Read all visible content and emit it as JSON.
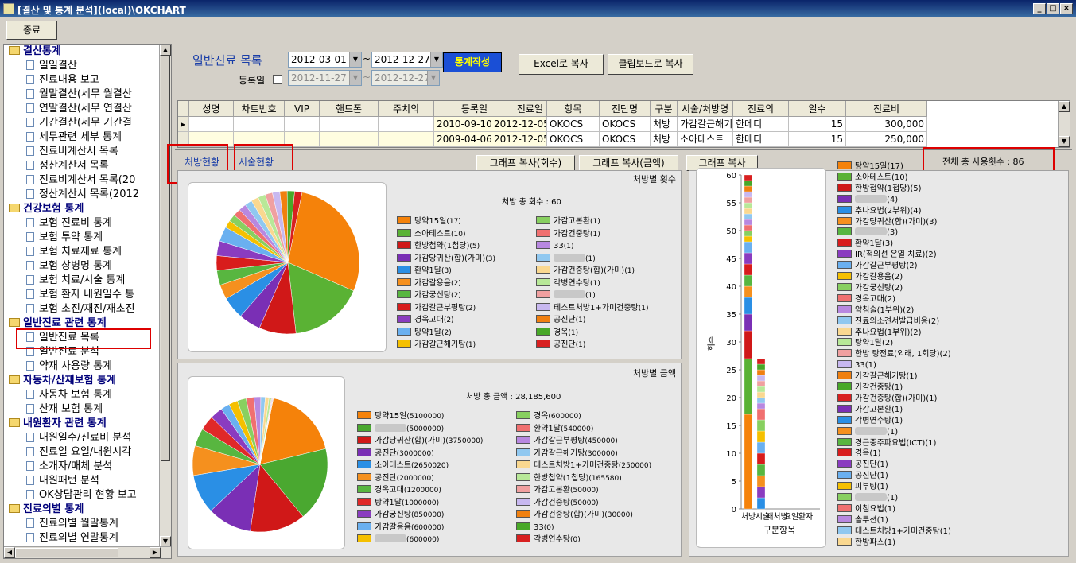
{
  "window": {
    "title": "[결산 및 통계 분석](local)\\OKCHART"
  },
  "toolbar": {
    "close_label": "종료"
  },
  "tree": [
    {
      "t": "h",
      "label": "결산통계"
    },
    {
      "t": "i",
      "label": "일일결산"
    },
    {
      "t": "i",
      "label": "진료내용 보고"
    },
    {
      "t": "i",
      "label": "월말결산(세무 월결산"
    },
    {
      "t": "i",
      "label": "연말결산(세무 연결산"
    },
    {
      "t": "i",
      "label": "기간결산(세무 기간결"
    },
    {
      "t": "i",
      "label": "세무관련 세부 통계"
    },
    {
      "t": "i",
      "label": "진료비계산서 목록"
    },
    {
      "t": "i",
      "label": "정산계산서 목록"
    },
    {
      "t": "i",
      "label": "진료비계산서 목록(20"
    },
    {
      "t": "i",
      "label": "정산계산서 목록(2012"
    },
    {
      "t": "h",
      "label": "건강보험 통계"
    },
    {
      "t": "i",
      "label": "보험 진료비 통계"
    },
    {
      "t": "i",
      "label": "보험 투약 통계"
    },
    {
      "t": "i",
      "label": "보험 치료재료 통계"
    },
    {
      "t": "i",
      "label": "보험 상병명 통계"
    },
    {
      "t": "i",
      "label": "보험 치료/시술 통계"
    },
    {
      "t": "i",
      "label": "보험 환자 내원일수 통"
    },
    {
      "t": "i",
      "label": "보험 초진/재진/재초진"
    },
    {
      "t": "h",
      "label": "일반진료 관련 통계"
    },
    {
      "t": "i",
      "label": "일반진료 목록"
    },
    {
      "t": "i",
      "label": "일반진료 분석"
    },
    {
      "t": "i",
      "label": "약재 사용량 통계"
    },
    {
      "t": "h",
      "label": "자동차/산재보험 통계"
    },
    {
      "t": "i",
      "label": "자동차 보험 통계"
    },
    {
      "t": "i",
      "label": "산재 보험 통계"
    },
    {
      "t": "h",
      "label": "내원환자 관련 통계"
    },
    {
      "t": "i",
      "label": "내원일수/진료비 분석"
    },
    {
      "t": "i",
      "label": "진료일 요일/내원시각"
    },
    {
      "t": "i",
      "label": "소개자/매체 분석"
    },
    {
      "t": "i",
      "label": "내원패턴 분석"
    },
    {
      "t": "i",
      "label": "OK상담관리 현황 보고"
    },
    {
      "t": "h",
      "label": "진료의별 통계"
    },
    {
      "t": "i",
      "label": "진료의별 월말통계"
    },
    {
      "t": "i",
      "label": "진료의별 연말통계"
    }
  ],
  "header": {
    "title": "일반진료 목록",
    "reg_label": "등록일",
    "tilde": "~",
    "from": "2012-03-01",
    "to": "2012-12-27",
    "reg_from": "2012-11-27",
    "reg_to": "2012-12-27",
    "stat_btn": "통계작성",
    "excel_btn": "Excel로 복사",
    "clip_btn": "클립보드로 복사"
  },
  "grid": {
    "columns": [
      "성명",
      "차트번호",
      "VIP",
      "핸드폰",
      "주치의",
      "등록일",
      "진료일",
      "항목",
      "진단명",
      "구분",
      "시술/처방명",
      "진료의",
      "일수",
      "진료비"
    ],
    "rows": [
      [
        "",
        "",
        "",
        "",
        "",
        "2010-09-10",
        "2012-12-05",
        "OKOCS",
        "OKOCS",
        "처방",
        "가감갈근해기",
        "한메디",
        "15",
        "300,000"
      ],
      [
        "",
        "",
        "",
        "",
        "",
        "2009-04-06",
        "2012-12-05",
        "OKOCS",
        "OKOCS",
        "처방",
        "소아테스트",
        "한메디",
        "15",
        "250,000"
      ]
    ]
  },
  "tabs": {
    "t1": "처방현황",
    "t2": "시술현황"
  },
  "buttons": {
    "copy_count": "그래프 복사(회수)",
    "copy_amount": "그래프 복사(금액)",
    "copy_graph": "그래프 복사"
  },
  "total_label": "전체 총 사용횟수 : 86",
  "count_panel": {
    "title": "처방별 횟수",
    "total": "처방 총 회수 : 60",
    "legend_left": [
      [
        "탕약15일",
        "(17)",
        "#f5820a"
      ],
      [
        "소아테스트",
        "(10)",
        "#5ab234"
      ],
      [
        "한방첩약(1첩당)",
        "(5)",
        "#d01818"
      ],
      [
        "가감당귀산(합)(가미)",
        "(3)",
        "#7a2fb5"
      ],
      [
        "환약1달",
        "(3)",
        "#2a8fe5"
      ],
      [
        "가감갈용음",
        "(2)",
        "#f5901e"
      ],
      [
        "가감궁신탕",
        "(2)",
        "#58b640"
      ],
      [
        "가감갈근부평탕",
        "(2)",
        "#d81c1c"
      ],
      [
        "경옥고대",
        "(2)",
        "#8a3cc0"
      ],
      [
        "탕약1달",
        "(2)",
        "#6ab0f0"
      ],
      [
        "가감갈근해기탕",
        "(1)",
        "#f5c000"
      ]
    ],
    "legend_right": [
      [
        "가감고본환",
        "(1)",
        "#88d060"
      ],
      [
        "가감건중탕",
        "(1)",
        "#f07070"
      ],
      [
        "33",
        "(1)",
        "#b888e0"
      ],
      [
        "",
        "(1)",
        "#90c8f0"
      ],
      [
        "가감건중탕(합)(가미)",
        "(1)",
        "#fad890"
      ],
      [
        "각병연수탕",
        "(1)",
        "#b8e898"
      ],
      [
        "",
        "(1)",
        "#f0a0a0"
      ],
      [
        "테스트처방1+가미건중탕",
        "(1)",
        "#c8b8f0"
      ],
      [
        "공진단",
        "(1)",
        "#f08010"
      ],
      [
        "경옥",
        "(1)",
        "#48a828"
      ],
      [
        "공진단",
        "(1)",
        "#d82020"
      ]
    ]
  },
  "amount_panel": {
    "title": "처방별 금액",
    "total": "처방 총 금액 : 28,185,600",
    "legend_left": [
      [
        "탕약15일",
        "(5100000)",
        "#f5820a"
      ],
      [
        "",
        "(5000000)",
        "#4aa830"
      ],
      [
        "가감당귀산(합)(가미)",
        "(3750000)",
        "#d01818"
      ],
      [
        "공진단",
        "(3000000)",
        "#7a2fb5"
      ],
      [
        "소아테스트",
        "(2650020)",
        "#2a8fe5"
      ],
      [
        "공진단",
        "(2000000)",
        "#f5901e"
      ],
      [
        "경옥고대",
        "(1200000)",
        "#58b640"
      ],
      [
        "탕약1달",
        "(1000000)",
        "#e02828"
      ],
      [
        "가감궁신탕",
        "(850000)",
        "#8a3cc0"
      ],
      [
        "가감갈용음",
        "(600000)",
        "#6ab0f0"
      ],
      [
        "",
        "(600000)",
        "#f5c000"
      ]
    ],
    "legend_right": [
      [
        "경옥",
        "(600000)",
        "#88d060"
      ],
      [
        "환약1달",
        "(540000)",
        "#f07070"
      ],
      [
        "가감갈근부평탕",
        "(450000)",
        "#b888e0"
      ],
      [
        "가감갈근해기탕",
        "(300000)",
        "#90c8f0"
      ],
      [
        "테스트처방1+가미건중탕",
        "(250000)",
        "#fad890"
      ],
      [
        "한방첩약(1첩당)",
        "(165580)",
        "#b8e898"
      ],
      [
        "가감고본환",
        "(50000)",
        "#f0a0a0"
      ],
      [
        "가감건중탕",
        "(50000)",
        "#c8b8f0"
      ],
      [
        "가감건중탕(합)(가미)",
        "(30000)",
        "#f08010"
      ],
      [
        "33",
        "(0)",
        "#48a828"
      ],
      [
        "각병연수탕",
        "(0)",
        "#d82020"
      ]
    ]
  },
  "bar_panel": {
    "ylabel": "회수",
    "xlabel": "구분항목",
    "xticks": [
      "처방",
      "시술",
      "재처방",
      "요일",
      "환자"
    ],
    "yticks": [
      "0",
      "5",
      "10",
      "15",
      "20",
      "25",
      "30",
      "35",
      "40",
      "45",
      "50",
      "55",
      "60"
    ],
    "legend": [
      [
        "탕약15일(17)",
        "#f5820a"
      ],
      [
        "소아테스트(10)",
        "#5ab234"
      ],
      [
        "한방첩약(1첩당)(5)",
        "#d01818"
      ],
      [
        "(4)",
        "#7a2fb5"
      ],
      [
        "추나요법(2부위)(4)",
        "#2a8fe5"
      ],
      [
        "가감당귀산(합)(가미)(3)",
        "#f5901e"
      ],
      [
        "(3)",
        "#58b640"
      ],
      [
        "환약1달(3)",
        "#d81c1c"
      ],
      [
        "IR(적외선 온열 치료)(2)",
        "#8a3cc0"
      ],
      [
        "가감갈근부평탕(2)",
        "#6ab0f0"
      ],
      [
        "가감갈용음(2)",
        "#f5c000"
      ],
      [
        "가감궁신탕(2)",
        "#88d060"
      ],
      [
        "경옥고대(2)",
        "#f07070"
      ],
      [
        "약침술(1부위)(2)",
        "#b888e0"
      ],
      [
        "진료의소견서발급비용(2)",
        "#90c8f0"
      ],
      [
        "추나요법(1부위)(2)",
        "#fad890"
      ],
      [
        "탕약1달(2)",
        "#b8e898"
      ],
      [
        "한방 탕전료(외래, 1회당)(2)",
        "#f0a0a0"
      ],
      [
        "33(1)",
        "#c8b8f0"
      ],
      [
        "가감갈근해기탕(1)",
        "#f08010"
      ],
      [
        "가감건중탕(1)",
        "#48a828"
      ],
      [
        "가감건중탕(합)(가미)(1)",
        "#d82020"
      ],
      [
        "가감고본환(1)",
        "#7a2fb5"
      ],
      [
        "각병연수탕(1)",
        "#2a8fe5"
      ],
      [
        "(1)",
        "#f5901e"
      ],
      [
        "경근중주파요법(ICT)(1)",
        "#58b640"
      ],
      [
        "경옥(1)",
        "#d81c1c"
      ],
      [
        "공진단(1)",
        "#8a3cc0"
      ],
      [
        "공진단(1)",
        "#6ab0f0"
      ],
      [
        "피부탕(1)",
        "#f5c000"
      ],
      [
        "(1)",
        "#88d060"
      ],
      [
        "이침요법(1)",
        "#f07070"
      ],
      [
        "솔루션(1)",
        "#b888e0"
      ],
      [
        "테스트처방1+가미건중탕(1)",
        "#90c8f0"
      ],
      [
        "한방파스(1)",
        "#fad890"
      ]
    ]
  }
}
